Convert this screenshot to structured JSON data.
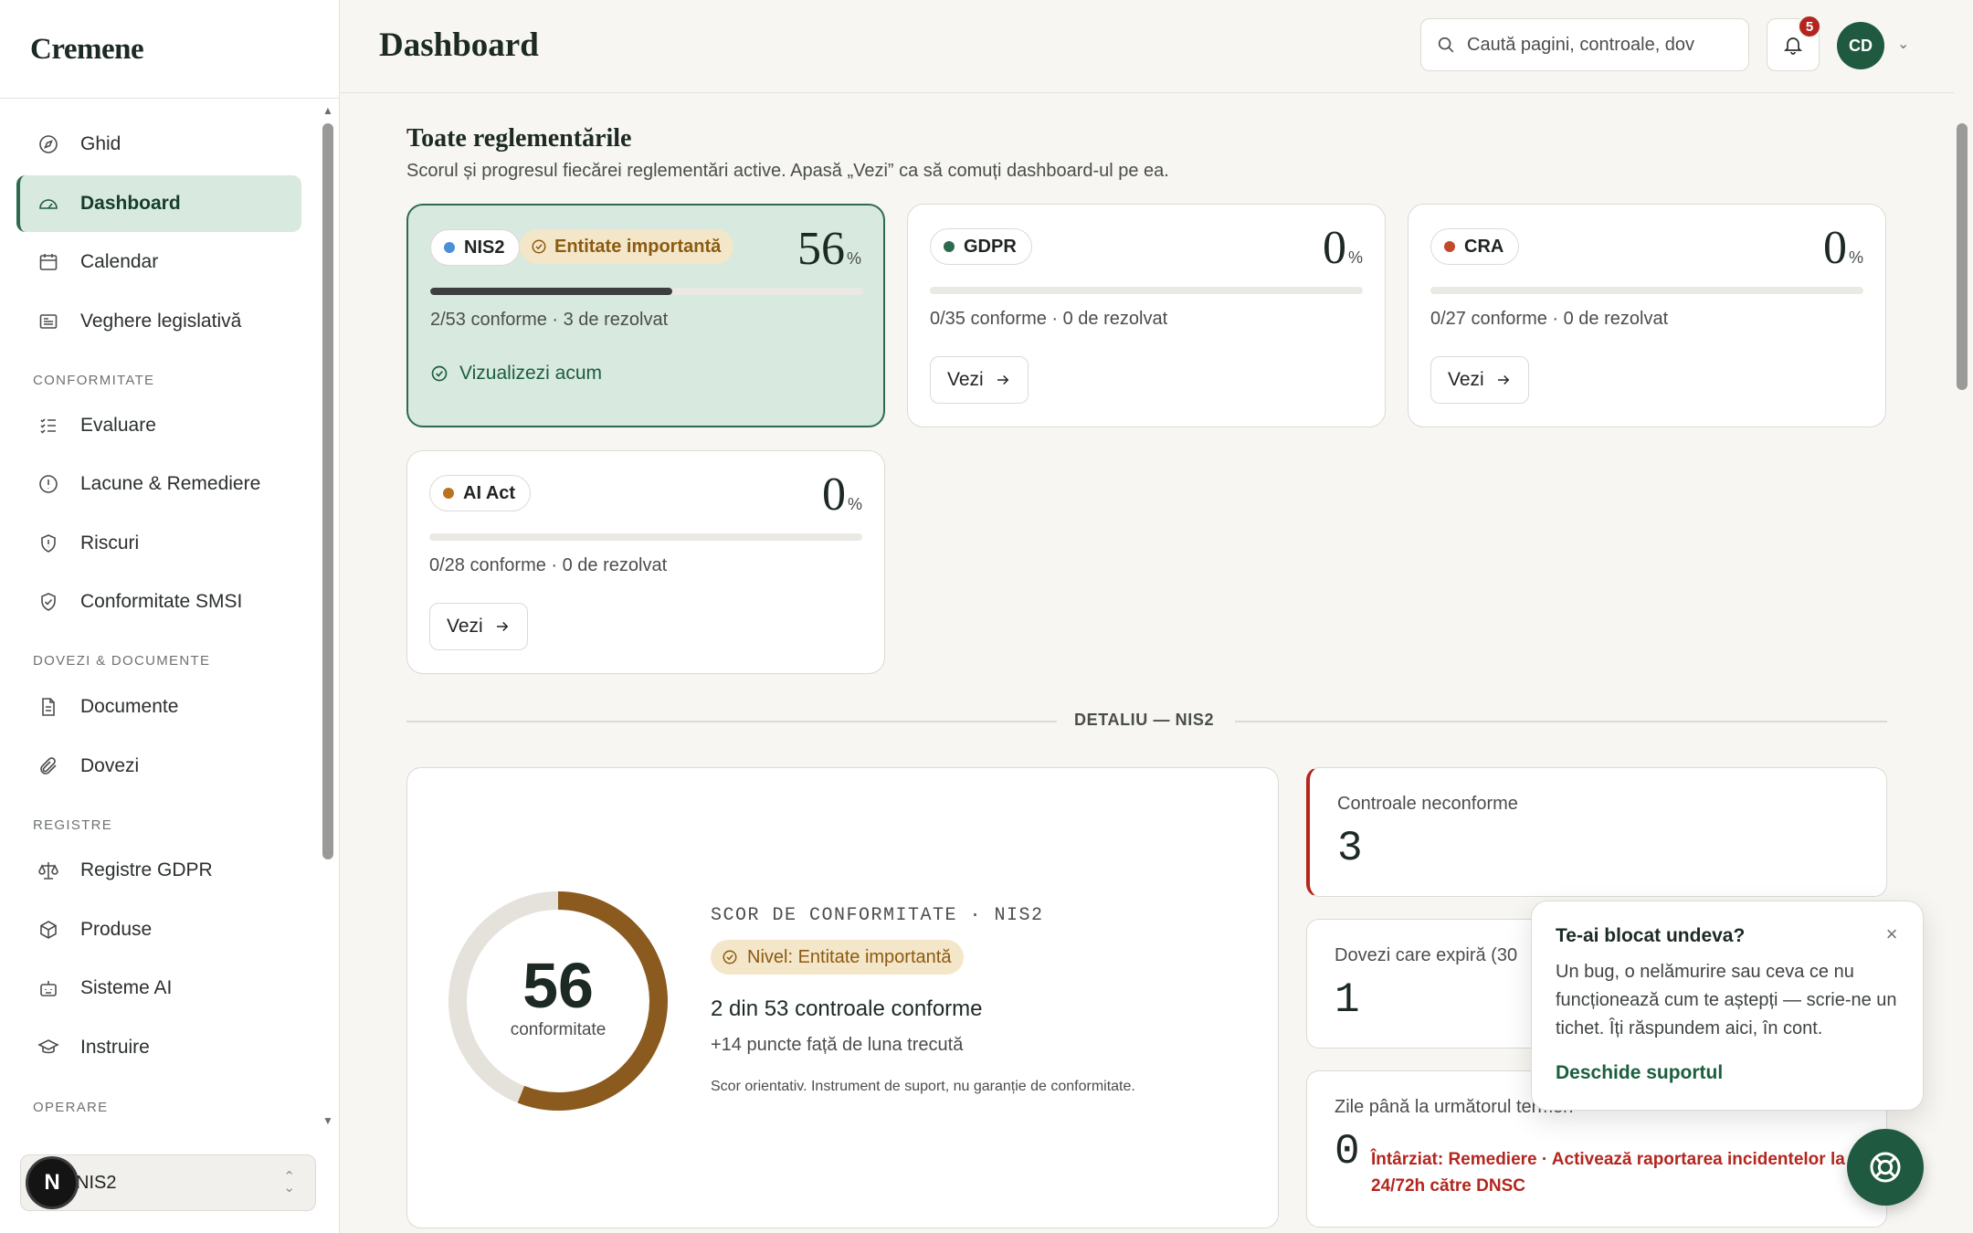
{
  "app": {
    "brand": "Cremene"
  },
  "sidebar": {
    "items_top": [
      {
        "label": "Ghid",
        "icon": "compass-icon"
      },
      {
        "label": "Dashboard",
        "icon": "gauge-icon",
        "active": true
      },
      {
        "label": "Calendar",
        "icon": "calendar-icon"
      },
      {
        "label": "Veghere legislativă",
        "icon": "newspaper-icon"
      }
    ],
    "sections": [
      {
        "title": "CONFORMITATE",
        "items": [
          {
            "label": "Evaluare",
            "icon": "checklist-icon"
          },
          {
            "label": "Lacune & Remediere",
            "icon": "alert-circle-icon"
          },
          {
            "label": "Riscuri",
            "icon": "shield-alert-icon"
          },
          {
            "label": "Conformitate SMSI",
            "icon": "shield-check-icon"
          }
        ]
      },
      {
        "title": "DOVEZI & DOCUMENTE",
        "items": [
          {
            "label": "Documente",
            "icon": "file-icon"
          },
          {
            "label": "Dovezi",
            "icon": "paperclip-icon"
          }
        ]
      },
      {
        "title": "REGISTRE",
        "items": [
          {
            "label": "Registre GDPR",
            "icon": "scale-icon"
          },
          {
            "label": "Produse",
            "icon": "box-icon"
          },
          {
            "label": "Sisteme AI",
            "icon": "bot-icon"
          },
          {
            "label": "Instruire",
            "icon": "graduation-cap-icon"
          }
        ]
      },
      {
        "title": "OPERARE",
        "items": []
      }
    ],
    "regulation_switcher": {
      "value": "NIS2",
      "badge": "N"
    }
  },
  "header": {
    "title": "Dashboard",
    "search_placeholder": "Caută pagini, controale, dov",
    "notifications_count": "5",
    "avatar_initials": "CD"
  },
  "regulations": {
    "title": "Toate reglementările",
    "subtitle": "Scorul și progresul fiecărei reglementări active. Apasă „Vezi” ca să comuți dashboard-ul pe ea.",
    "cards": [
      {
        "name": "NIS2",
        "dot_color": "#4a90d9",
        "entity": "Entitate importantă",
        "percent": "56",
        "percent_unit": "%",
        "progress": 0.56,
        "stats": "2/53 conforme · 3 de rezolvat",
        "status": "Vizualizezi acum",
        "selected": true
      },
      {
        "name": "GDPR",
        "dot_color": "#2d6a4f",
        "percent": "0",
        "percent_unit": "%",
        "progress": 0,
        "stats": "0/35 conforme · 0 de rezolvat",
        "action": "Vezi"
      },
      {
        "name": "CRA",
        "dot_color": "#c2492c",
        "percent": "0",
        "percent_unit": "%",
        "progress": 0,
        "stats": "0/27 conforme · 0 de rezolvat",
        "action": "Vezi"
      },
      {
        "name": "AI Act",
        "dot_color": "#b87320",
        "percent": "0",
        "percent_unit": "%",
        "progress": 0,
        "stats": "0/28 conforme · 0 de rezolvat",
        "action": "Vezi"
      }
    ]
  },
  "detail": {
    "divider_label": "DETALIU — NIS2",
    "score": {
      "value": "56",
      "fraction": 0.56,
      "value_label": "conformitate",
      "kicker": "SCOR DE CONFORMITATE · NIS2",
      "level": "Nivel: Entitate importantă",
      "main": "2 din 53 controale conforme",
      "delta": "+14 puncte față de luna trecută",
      "note": "Scor orientativ. Instrument de suport, nu garanție de conformitate."
    },
    "kpis": [
      {
        "label": "Controale neconforme",
        "value": "3"
      },
      {
        "label": "Dovezi care expiră (30",
        "value": "1"
      },
      {
        "label": "Zile până la următorul termen",
        "value": "0",
        "late": "Întârziat: Remediere · Activează raportarea incidentelor la 24/72h către DNSC"
      }
    ]
  },
  "help": {
    "title": "Te-ai blocat undeva?",
    "body": "Un bug, o nelămurire sau ceva ce nu funcționează cum te aștepți — scrie-ne un tichet. Îți răspundem aici, în cont.",
    "link": "Deschide suportul"
  },
  "colors": {
    "accent": "#2d6a4f",
    "accent_bg": "#d8e9df",
    "gauge": "#8b5a1f",
    "alert": "#b3261e",
    "entity_bg": "#f4e6c8"
  }
}
